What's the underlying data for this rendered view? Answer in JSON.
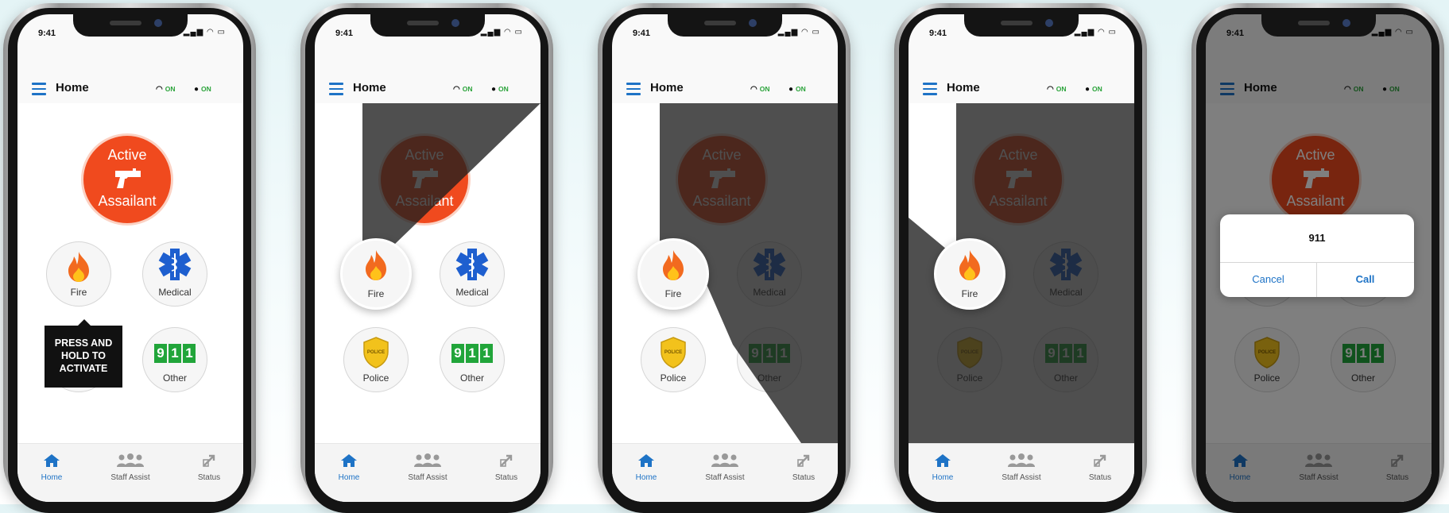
{
  "colors": {
    "brand_blue": "#1e73c6",
    "on_green": "#2aa33a",
    "alert_red": "#f04a1e",
    "nine_green": "#21a53a"
  },
  "status_bar": {
    "time": "9:41"
  },
  "header": {
    "title": "Home",
    "wifi_status": "ON",
    "location_status": "ON",
    "wifi_icon": "wifi-icon",
    "location_icon": "location-pin-icon",
    "menu_icon": "hamburger-menu-icon"
  },
  "buttons": {
    "active_assailant": {
      "line1": "Active",
      "line2": "Assailant",
      "icon": "gun-icon"
    },
    "fire": {
      "label": "Fire",
      "icon": "fire-icon"
    },
    "medical": {
      "label": "Medical",
      "icon": "star-of-life-icon"
    },
    "police": {
      "label": "Police",
      "icon": "police-badge-icon",
      "badge_text": "POLICE"
    },
    "other": {
      "label": "Other",
      "digits": [
        "9",
        "1",
        "1"
      ]
    }
  },
  "tooltip": {
    "text_lines": [
      "PRESS AND",
      "HOLD TO",
      "ACTIVATE"
    ]
  },
  "tabs": [
    {
      "label": "Home",
      "icon": "home-icon",
      "active": true
    },
    {
      "label": "Staff Assist",
      "icon": "group-icon",
      "active": false
    },
    {
      "label": "Status",
      "icon": "status-icon",
      "active": false
    }
  ],
  "hold_progress": [
    {
      "screen": 2,
      "description_fraction": 0.125
    },
    {
      "screen": 3,
      "description_fraction": 0.375
    },
    {
      "screen": 4,
      "description_fraction": 0.875
    }
  ],
  "dialog": {
    "title": "911",
    "cancel_label": "Cancel",
    "call_label": "Call"
  }
}
